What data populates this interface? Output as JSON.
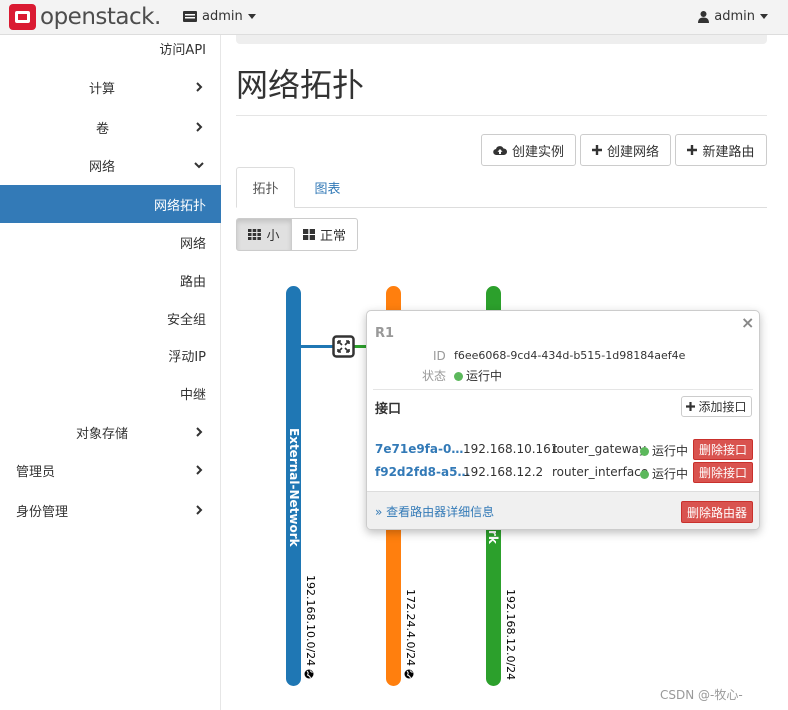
{
  "header": {
    "logo_text": "openstack.",
    "project": "admin",
    "user": "admin"
  },
  "sidebar": {
    "items": [
      {
        "label": "访问API"
      },
      {
        "label": "计算"
      },
      {
        "label": "卷"
      },
      {
        "label": "网络"
      },
      {
        "label": "网络拓扑"
      },
      {
        "label": "网络"
      },
      {
        "label": "路由"
      },
      {
        "label": "安全组"
      },
      {
        "label": "浮动IP"
      },
      {
        "label": "中继"
      },
      {
        "label": "对象存储"
      },
      {
        "label": "管理员"
      },
      {
        "label": "身份管理"
      }
    ]
  },
  "main": {
    "title": "网络拓扑",
    "actions": {
      "create_instance": "创建实例",
      "create_network": "创建网络",
      "create_router": "新建路由"
    },
    "tabs": [
      {
        "label": "拓扑"
      },
      {
        "label": "图表"
      }
    ],
    "view_toggle": {
      "small": "小",
      "normal": "正常"
    }
  },
  "topology": {
    "networks": [
      {
        "name": "External-Network",
        "cidr": "192.168.10.0/24",
        "color": "#1f77b4"
      },
      {
        "name": "",
        "cidr": "172.24.4.0/24",
        "color": "#ff7f0e"
      },
      {
        "name": "rk",
        "cidr": "192.168.12.0/24",
        "color": "#2ca02c"
      }
    ]
  },
  "router_popup": {
    "name": "R1",
    "id_label": "ID",
    "id_value": "f6ee6068-9cd4-434d-b515-1d98184aef4e",
    "status_label": "状态",
    "status_value": "运行中",
    "interfaces_title": "接口",
    "add_interface": "添加接口",
    "interfaces": [
      {
        "id": "7e71e9fa-0…",
        "ip": "192.168.10.161",
        "type": "router_gateway",
        "status": "运行中",
        "delete": "删除接口"
      },
      {
        "id": "f92d2fd8-a5…",
        "ip": "192.168.12.2",
        "type": "router_interface",
        "status": "运行中",
        "delete": "删除接口"
      }
    ],
    "details_link": "» 查看路由器详细信息",
    "delete_router": "删除路由器",
    "close": "×"
  },
  "watermark": "CSDN @-牧心-"
}
